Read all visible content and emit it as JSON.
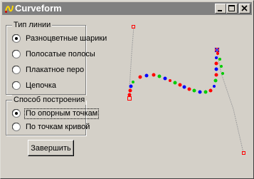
{
  "window": {
    "title": "Curveform",
    "icon": "app-curve-icon"
  },
  "title_buttons": {
    "minimize_icon": "minimize-icon",
    "maximize_icon": "maximize-icon",
    "close_icon": "close-icon"
  },
  "line_types": {
    "caption": "Тип линии",
    "options": [
      {
        "label": "Разноцветные шарики",
        "selected": true
      },
      {
        "label": "Полосатые полосы",
        "selected": false
      },
      {
        "label": "Плакатное перо",
        "selected": false
      },
      {
        "label": "Цепочка",
        "selected": false
      }
    ]
  },
  "build_method": {
    "caption": "Способ построения",
    "options": [
      {
        "label": "По опорным точкам",
        "selected": true,
        "focused": true
      },
      {
        "label": "По точкам кривой",
        "selected": false,
        "focused": false
      }
    ]
  },
  "finish_button": {
    "label": "Завершить"
  },
  "curve": {
    "dot_colors": [
      "#ff0000",
      "#00cc00",
      "#0000ff"
    ],
    "guide_color": "#a0a0a0",
    "control_marker_color": "#ff0000"
  }
}
